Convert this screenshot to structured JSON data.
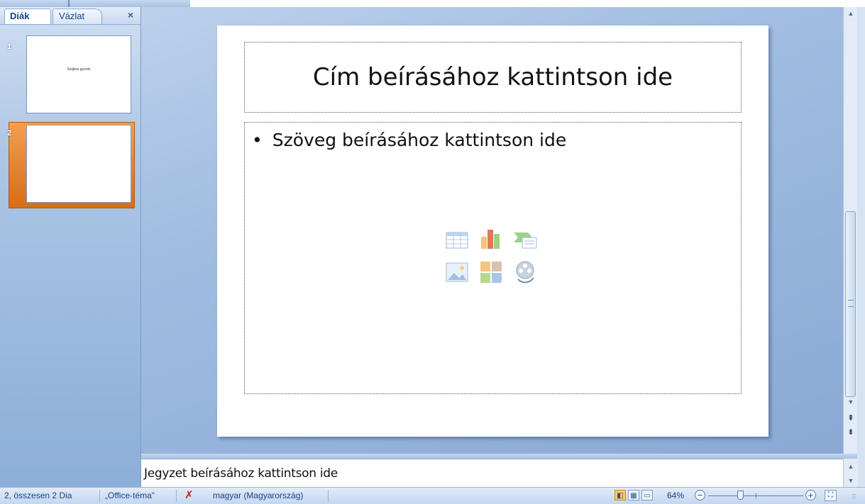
{
  "pane": {
    "tabs": [
      {
        "label": "Diák",
        "active": true
      },
      {
        "label": "Vázlat",
        "active": false
      }
    ],
    "close_label": "×"
  },
  "thumbnails": [
    {
      "number": "1",
      "title": "Szájbar gyerek",
      "selected": false
    },
    {
      "number": "2",
      "title": "",
      "selected": true
    }
  ],
  "slide": {
    "title_placeholder": "Cím beírásához kattintson ide",
    "content_placeholder": "Szöveg beírásához kattintson ide",
    "bullet": "•",
    "insert_icons": [
      "table-icon",
      "chart-icon",
      "smartart-icon",
      "picture-icon",
      "clipart-icon",
      "media-icon"
    ]
  },
  "notes": {
    "placeholder": "Jegyzet beírásához kattintson ide"
  },
  "statusbar": {
    "slide_position": "2, összesen 2 Dia",
    "theme": "„Office-téma”",
    "language": "magyar (Magyarország)",
    "zoom": "64%",
    "zoom_level_percent": 64
  },
  "colors": {
    "selected_thumb": "#e07a22",
    "accent": "#15428b"
  }
}
